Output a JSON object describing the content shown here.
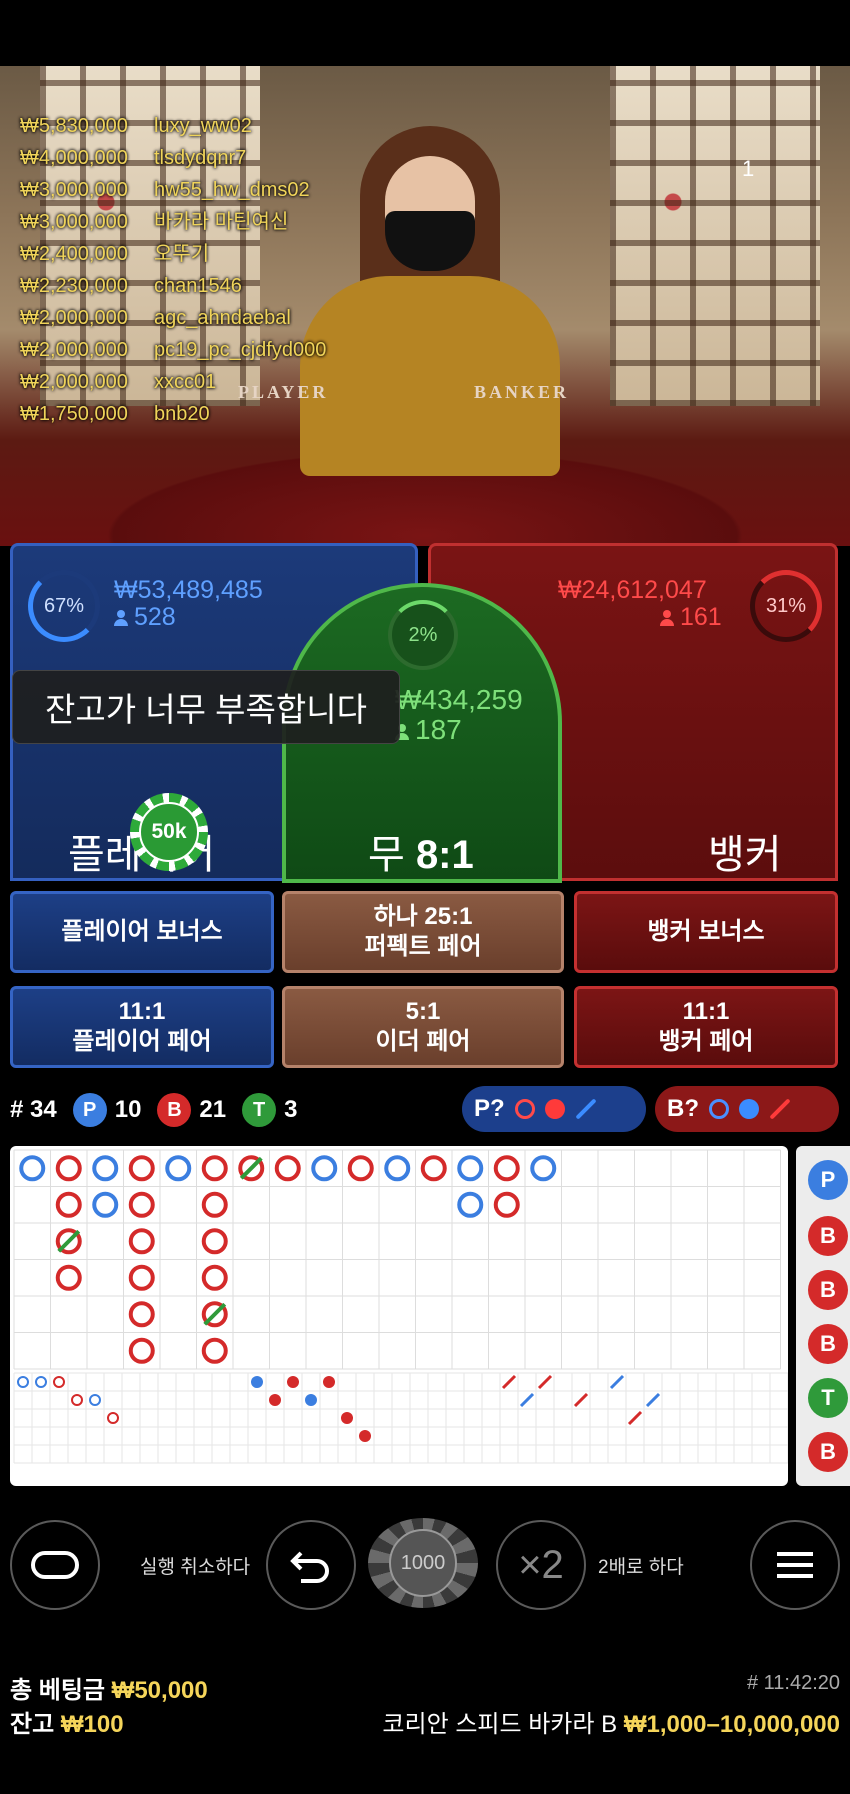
{
  "stream": {
    "camera_number": "1",
    "table_labels": {
      "player": "PLAYER",
      "banker": "BANKER"
    }
  },
  "leaderboard": [
    {
      "amount": "₩5,830,000",
      "name": "luxy_ww02"
    },
    {
      "amount": "₩4,000,000",
      "name": "tlsdydqnr7"
    },
    {
      "amount": "₩3,000,000",
      "name": "hw55_hw_dms02"
    },
    {
      "amount": "₩3,000,000",
      "name": "바카라 마틴여신"
    },
    {
      "amount": "₩2,400,000",
      "name": "오뚜기"
    },
    {
      "amount": "₩2,230,000",
      "name": "chan1546"
    },
    {
      "amount": "₩2,000,000",
      "name": "agc_ahndaebal"
    },
    {
      "amount": "₩2,000,000",
      "name": "pc19_pc_cjdfyd000"
    },
    {
      "amount": "₩2,000,000",
      "name": "xxcc01"
    },
    {
      "amount": "₩1,750,000",
      "name": "bnb20"
    }
  ],
  "bets": {
    "player": {
      "percent": "67%",
      "amount": "₩53,489,485",
      "count": "528",
      "label": "플레이어"
    },
    "banker": {
      "percent": "31%",
      "amount": "₩24,612,047",
      "count": "161",
      "label": "뱅커"
    },
    "tie": {
      "percent": "2%",
      "amount": "₩434,259",
      "count": "187",
      "label_prefix": "무",
      "label_odds": "8:1"
    },
    "placed_chip": "50k"
  },
  "toast": "잔고가 너무 부족합니다",
  "side_bets": {
    "player_bonus": "플레이어 보너스",
    "perfect_pair_line1": "하나 25:1",
    "perfect_pair_line2": "퍼펙트 페어",
    "banker_bonus": "뱅커 보너스",
    "player_pair_odds": "11:1",
    "player_pair": "플레이어 페어",
    "either_pair_odds": "5:1",
    "either_pair": "이더 페어",
    "banker_pair_odds": "11:1",
    "banker_pair": "뱅커 페어"
  },
  "stats": {
    "round": "# 34",
    "player": "10",
    "banker": "21",
    "tie": "3",
    "p_letter": "P",
    "b_letter": "B",
    "t_letter": "T"
  },
  "ask": {
    "player": "P?",
    "banker": "B?"
  },
  "prediction_column": [
    "P",
    "B",
    "B",
    "B",
    "T",
    "B"
  ],
  "controls": {
    "undo_label": "실행 취소하다",
    "chip_value": "1000",
    "double_icon": "×2",
    "double_label": "2배로 하다"
  },
  "footer": {
    "total_bet_label": "총 베팅금",
    "total_bet_value": "₩50,000",
    "balance_label": "잔고",
    "balance_value": "₩100",
    "time": "# 11:42:20",
    "table_name": "코리안 스피드 바카라 B",
    "limits": "₩1,000–10,000,000"
  },
  "colors": {
    "player": "#3b8cff",
    "banker": "#e03030",
    "tie": "#2f9a3a",
    "gold": "#f5d55a"
  }
}
